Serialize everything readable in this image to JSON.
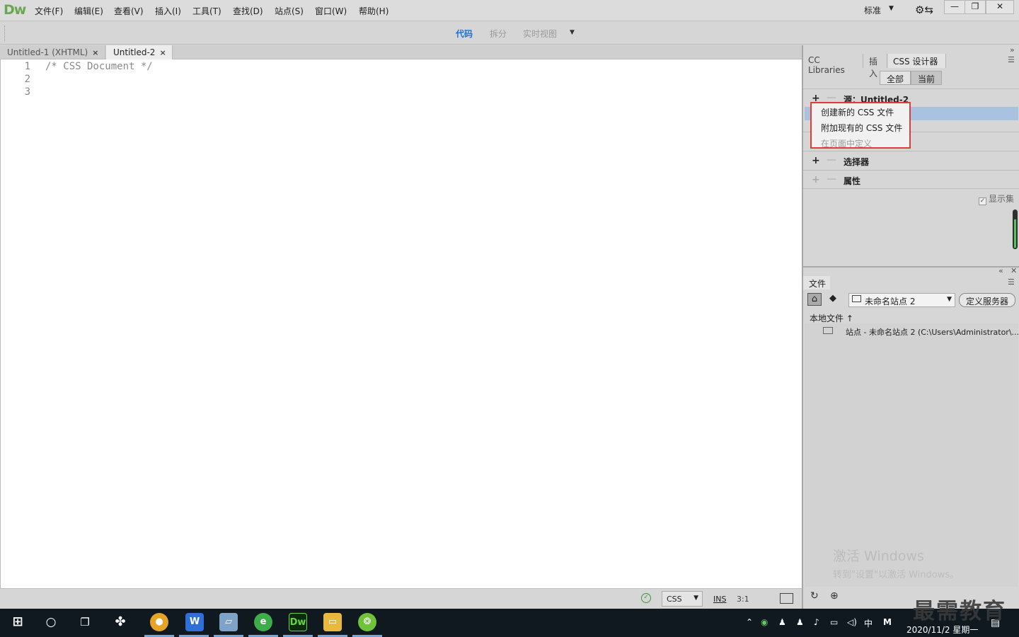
{
  "app": {
    "logo": "Dw",
    "menu": [
      "文件(F)",
      "编辑(E)",
      "查看(V)",
      "插入(I)",
      "工具(T)",
      "查找(D)",
      "站点(S)",
      "窗口(W)",
      "帮助(H)"
    ],
    "workspace": "标准"
  },
  "view_toolbar": {
    "tabs": [
      "代码",
      "拆分",
      "实时视图"
    ],
    "active": "代码"
  },
  "documents": {
    "tabs": [
      "Untitled-1 (XHTML)",
      "Untitled-2"
    ],
    "active": "Untitled-2"
  },
  "editor": {
    "lines": [
      {
        "num": "1",
        "text": "/* CSS Document */"
      },
      {
        "num": "2",
        "text": ""
      },
      {
        "num": "3",
        "text": ""
      }
    ]
  },
  "status_bar": {
    "language": "CSS",
    "mode": "INS",
    "position": "3:1"
  },
  "css_panel": {
    "tabs": [
      "CC Libraries",
      "插入",
      "CSS 设计器"
    ],
    "active_tab": "CSS 设计器",
    "toggle": [
      "全部",
      "当前"
    ],
    "sources_title": "源：Untitled-2",
    "selectors_title": "选择器",
    "properties_title": "属性",
    "show_set": "显示集",
    "popup_menu": [
      {
        "label": "创建新的 CSS 文件",
        "enabled": true
      },
      {
        "label": "附加现有的 CSS 文件",
        "enabled": true
      },
      {
        "label": "在页面中定义",
        "enabled": false
      }
    ]
  },
  "files_panel": {
    "tab": "文件",
    "site_select": "未命名站点 2",
    "define_server": "定义服务器",
    "local_files": "本地文件",
    "site_row": "站点 - 未命名站点 2 (C:\\Users\\Administrator\\...",
    "watermark_line1": "激活 Windows",
    "watermark_line2": "转到\"设置\"以激活 Windows。"
  },
  "taskbar": {
    "date": "2020/11/2 星期一",
    "ime": "中",
    "brand": "最需教育"
  },
  "colors": {
    "accent": "#1a73d9",
    "highlight": "#e03c3c",
    "dw_green": "#6aa84f"
  }
}
